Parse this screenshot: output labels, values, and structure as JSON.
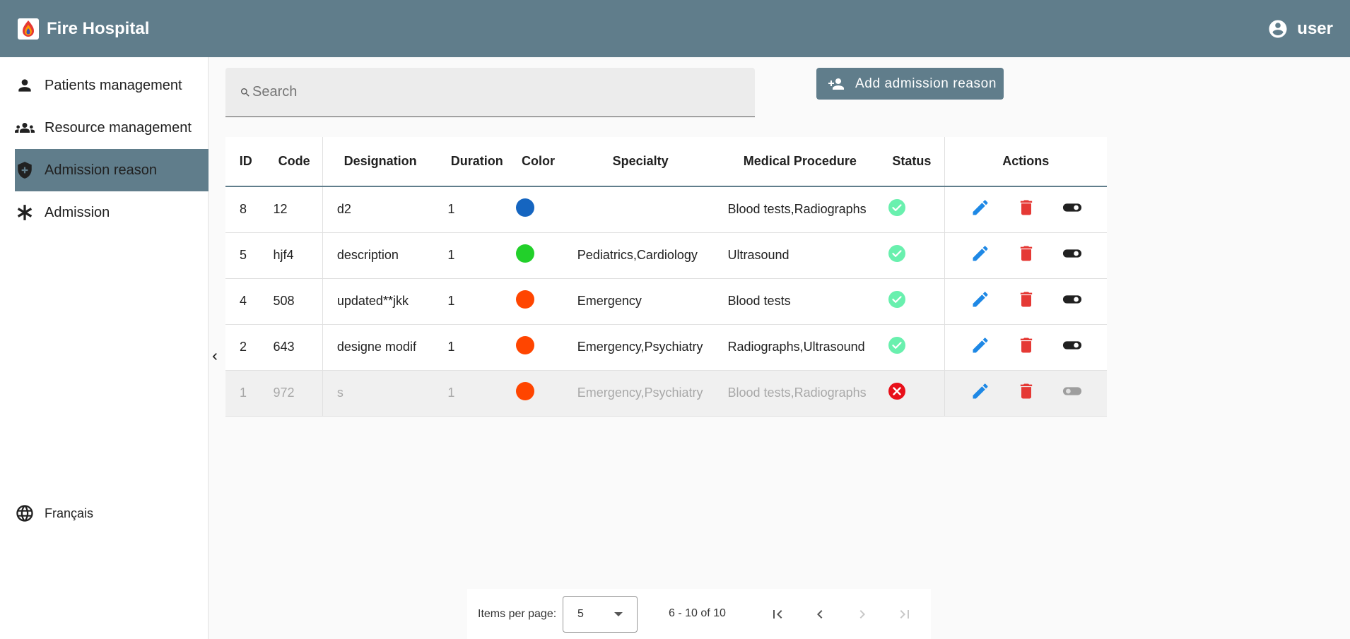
{
  "app": {
    "title": "Fire Hospital",
    "user": "user"
  },
  "sidebar": {
    "items": [
      {
        "label": "Patients management",
        "icon": "person-icon"
      },
      {
        "label": "Resource management",
        "icon": "groups-icon"
      },
      {
        "label": "Admission reason",
        "icon": "shield-plus-icon",
        "active": true
      },
      {
        "label": "Admission",
        "icon": "asterisk-icon"
      }
    ],
    "language": "Français"
  },
  "search": {
    "placeholder": "Search",
    "value": ""
  },
  "add_button": {
    "label": "Add admission reason"
  },
  "table": {
    "headers": [
      "ID",
      "Code",
      "Designation",
      "Duration",
      "Color",
      "Specialty",
      "Medical Procedure",
      "Status",
      "Actions"
    ],
    "rows": [
      {
        "id": "8",
        "code": "12",
        "designation": "d2",
        "duration": "1",
        "color": "#1565c0",
        "specialty": "",
        "procedure": "Blood tests,Radiographs",
        "status": "active"
      },
      {
        "id": "5",
        "code": "hjf4",
        "designation": "description",
        "duration": "1",
        "color": "#22d02a",
        "specialty": "Pediatrics,Cardiology",
        "procedure": "Ultrasound",
        "status": "active"
      },
      {
        "id": "4",
        "code": "508",
        "designation": "updated**jkk",
        "duration": "1",
        "color": "#ff4500",
        "specialty": "Emergency",
        "procedure": "Blood tests",
        "status": "active"
      },
      {
        "id": "2",
        "code": "643",
        "designation": "designe modif",
        "duration": "1",
        "color": "#ff4500",
        "specialty": "Emergency,Psychiatry",
        "procedure": "Radiographs,Ultrasound",
        "status": "active"
      },
      {
        "id": "1",
        "code": "972",
        "designation": "s",
        "duration": "1",
        "color": "#ff4500",
        "specialty": "Emergency,Psychiatry",
        "procedure": "Blood tests,Radiographs",
        "status": "inactive"
      }
    ]
  },
  "paginator": {
    "items_per_page_label": "Items per page:",
    "items_per_page": "5",
    "range_label": "6 - 10 of 10"
  },
  "colors": {
    "primary": "#607d8b",
    "edit": "#1e88e5",
    "delete": "#e53935",
    "status_ok": "#69f0ae",
    "status_off": "#e8101a"
  }
}
